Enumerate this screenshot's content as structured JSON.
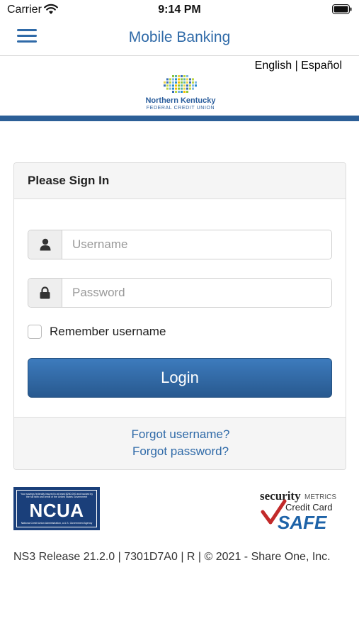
{
  "status_bar": {
    "carrier": "Carrier",
    "time": "9:14 PM"
  },
  "nav": {
    "title": "Mobile Banking"
  },
  "header": {
    "lang_english": "English",
    "lang_separator": " | ",
    "lang_spanish": "Español",
    "logo_name": "Northern Kentucky",
    "logo_sub": "FEDERAL CREDIT UNION"
  },
  "panel": {
    "heading": "Please Sign In",
    "username_placeholder": "Username",
    "password_placeholder": "Password",
    "remember_label": "Remember username",
    "login_label": "Login",
    "forgot_username": "Forgot username?",
    "forgot_password": "Forgot password?"
  },
  "badges": {
    "ncua_text": "NCUA",
    "ncua_top_fine": "Your savings federally insured to at least $250,000 and backed by the full faith and credit of the United States Government",
    "ncua_bottom_fine": "National Credit Union Administration, a U.S. Government Agency",
    "secmetrics_security": "security",
    "secmetrics_metrics": "METRICS",
    "secmetrics_credit": "Credit Card",
    "secmetrics_safe": "SAFE"
  },
  "footer": {
    "text": "NS3 Release 21.2.0 | 7301D7A0 | R | © 2021 - Share One, Inc."
  },
  "colors": {
    "brand_blue": "#2f6aa8",
    "header_rule": "#2c5f97",
    "ncua_navy": "#1a3f7a"
  }
}
